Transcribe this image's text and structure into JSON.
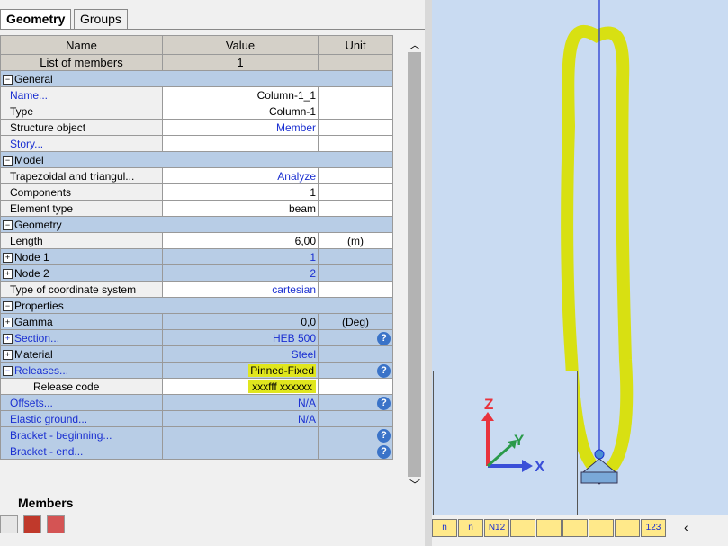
{
  "tabs": [
    "Geometry",
    "Groups"
  ],
  "grid": {
    "columns": [
      "Name",
      "Value",
      "Unit"
    ],
    "list_label": "List of members",
    "list_value": "1",
    "sections": {
      "general": "General",
      "model": "Model",
      "geometry": "Geometry",
      "properties": "Properties"
    },
    "general": [
      {
        "name": "Name...",
        "value": "Column-1_1",
        "unit": ""
      },
      {
        "name": "Type",
        "value": "Column-1",
        "unit": ""
      },
      {
        "name": "Structure object",
        "value": "Member",
        "unit": ""
      },
      {
        "name": "Story...",
        "value": "",
        "unit": ""
      }
    ],
    "model": [
      {
        "name": "Trapezoidal and triangul...",
        "value": "Analyze",
        "unit": ""
      },
      {
        "name": "Components",
        "value": "1",
        "unit": ""
      },
      {
        "name": "Element type",
        "value": "beam",
        "unit": ""
      }
    ],
    "geometry": [
      {
        "name": "Length",
        "value": "6,00",
        "unit": "(m)"
      },
      {
        "name": "Node 1",
        "value": "1",
        "unit": ""
      },
      {
        "name": "Node 2",
        "value": "2",
        "unit": ""
      },
      {
        "name": "Type of coordinate system",
        "value": "cartesian",
        "unit": ""
      }
    ],
    "properties": [
      {
        "name": "Gamma",
        "value": "0,0",
        "unit": "(Deg)"
      },
      {
        "name": "Section...",
        "value": "HEB 500",
        "unit": ""
      },
      {
        "name": "Material",
        "value": "Steel",
        "unit": ""
      },
      {
        "name": "Releases...",
        "value": "Pinned-Fixed",
        "unit": ""
      },
      {
        "name": "Release code",
        "value": "xxxfff xxxxxx",
        "unit": ""
      }
    ],
    "extra": [
      {
        "name": "Offsets...",
        "value": "N/A"
      },
      {
        "name": "Elastic ground...",
        "value": "N/A"
      },
      {
        "name": "Bracket - beginning...",
        "value": ""
      },
      {
        "name": "Bracket - end...",
        "value": ""
      }
    ]
  },
  "bottom_tab": "Members",
  "axes": {
    "z": "Z",
    "y": "Y",
    "x": "X"
  },
  "toolbar_right": [
    "n",
    "n",
    "N12",
    "",
    "",
    "",
    "",
    "",
    "123"
  ],
  "colors": {
    "highlight": "#e0e61e",
    "section_bg": "#b8cde6",
    "link": "#1a2fd1",
    "viewport": "#c9dbf2"
  }
}
